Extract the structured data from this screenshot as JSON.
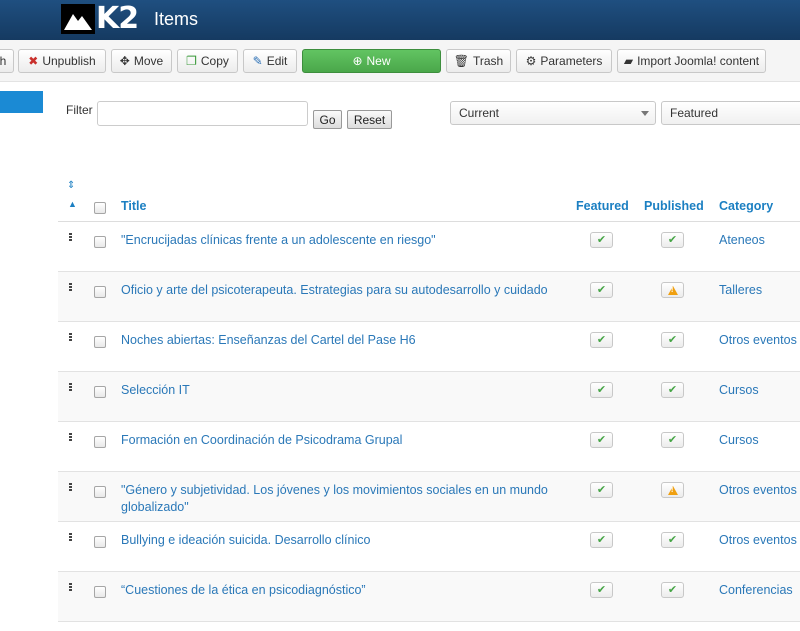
{
  "header": {
    "logo_text": "K2",
    "title": "Items"
  },
  "toolbar": {
    "buttons": [
      {
        "label": "h",
        "icon": "publish-icon"
      },
      {
        "label": "Unpublish",
        "icon": "unpublish-icon"
      },
      {
        "label": "Move",
        "icon": "move-icon"
      },
      {
        "label": "Copy",
        "icon": "copy-icon"
      },
      {
        "label": "Edit",
        "icon": "edit-icon"
      },
      {
        "label": "New",
        "icon": "plus-circle-icon"
      },
      {
        "label": "Trash",
        "icon": "trash-icon"
      },
      {
        "label": "Parameters",
        "icon": "gear-icon"
      },
      {
        "label": "Import Joomla! content",
        "icon": "import-icon"
      }
    ]
  },
  "filter": {
    "label": "Filter",
    "input_value": "",
    "go_label": "Go",
    "reset_label": "Reset",
    "select_status": "Current",
    "select_featured": "Featured"
  },
  "table": {
    "headers": {
      "title": "Title",
      "featured": "Featured",
      "published": "Published",
      "category": "Category"
    },
    "rows": [
      {
        "title": "\"Encrucijadas clínicas frente a un adolescente en riesgo\"",
        "featured": "yes",
        "published": "yes",
        "category": "Ateneos"
      },
      {
        "title": "Oficio y arte del psicoterapeuta. Estrategias para su autodesarrollo y cuidado",
        "featured": "yes",
        "published": "pending",
        "category": "Talleres"
      },
      {
        "title": "Noches abiertas: Enseñanzas del Cartel del Pase H6",
        "featured": "yes",
        "published": "yes",
        "category": "Otros eventos"
      },
      {
        "title": "Selección IT",
        "featured": "yes",
        "published": "yes",
        "category": "Cursos"
      },
      {
        "title": "Formación en Coordinación de Psicodrama Grupal",
        "featured": "yes",
        "published": "yes",
        "category": "Cursos"
      },
      {
        "title": "\"Género y subjetividad. Los jóvenes y los movimientos sociales en un mundo globalizado\"",
        "featured": "yes",
        "published": "pending",
        "category": "Otros eventos"
      },
      {
        "title": "Bullying e ideación suicida. Desarrollo clínico",
        "featured": "yes",
        "published": "yes",
        "category": "Otros eventos"
      },
      {
        "title": "“Cuestiones de la ética en psicodiagnóstico”",
        "featured": "yes",
        "published": "yes",
        "category": "Conferencias"
      }
    ]
  },
  "colors": {
    "header_bg": "#1a4570",
    "link": "#2a78b8",
    "new_button": "#52b352",
    "active_tab": "#1b8ad4",
    "warning": "#f0a010"
  }
}
